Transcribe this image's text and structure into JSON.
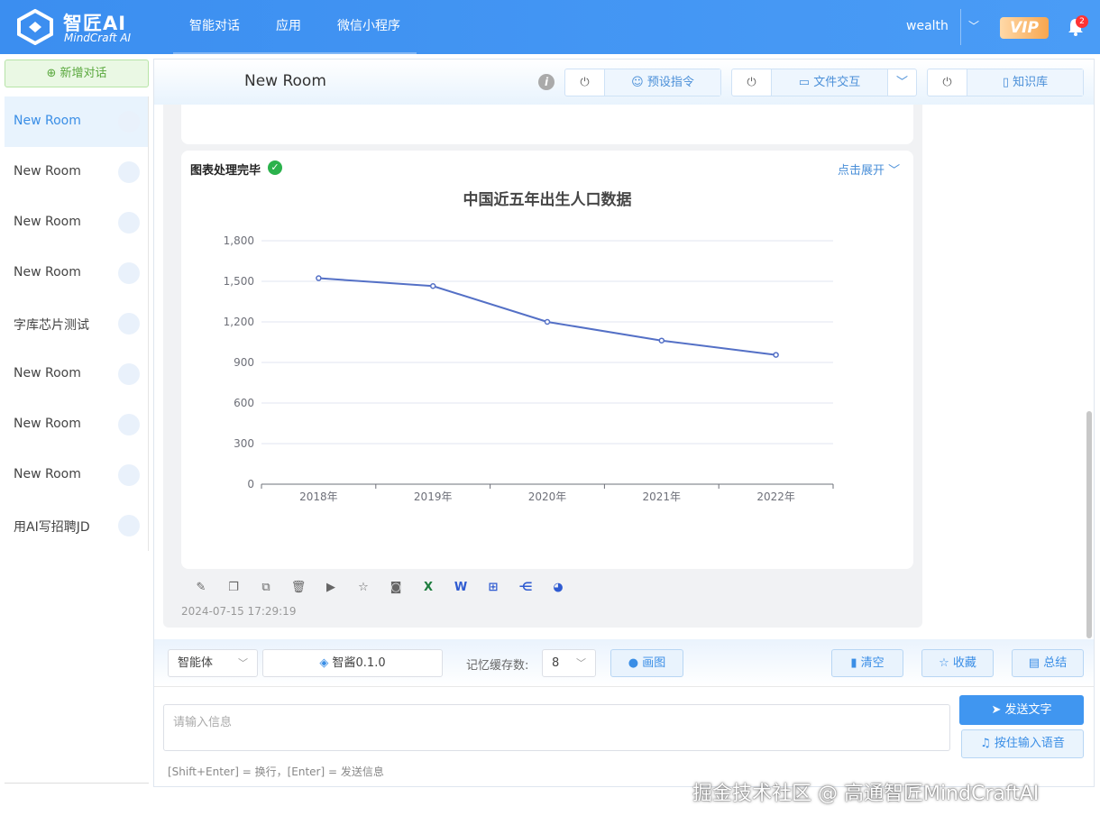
{
  "app": {
    "logo_title": "智匠AI",
    "logo_sub": "MindCraft AI",
    "nav": [
      "智能对话",
      "应用",
      "微信小程序"
    ],
    "user": "wealth",
    "vip": "VIP",
    "notifications": "2"
  },
  "sidebar": {
    "new_chat": "新增对话",
    "sessions": [
      "New Room",
      "New Room",
      "New Room",
      "New Room",
      "字库芯片测试",
      "New Room",
      "New Room",
      "New Room",
      "用AI写招聘JD"
    ]
  },
  "header": {
    "room_title": "New Room",
    "preset_label": "预设指令",
    "file_label": "文件交互",
    "kb_label": "知识库"
  },
  "message": {
    "status": "图表处理完毕",
    "expand": "点击展开",
    "timestamp": "2024-07-15 17:29:19"
  },
  "chart_data": {
    "type": "line",
    "title": "中国近五年出生人口数据",
    "categories": [
      "2018年",
      "2019年",
      "2020年",
      "2021年",
      "2022年"
    ],
    "values": [
      1523,
      1465,
      1200,
      1062,
      956
    ],
    "y_ticks": [
      "0",
      "300",
      "600",
      "900",
      "1,200",
      "1,500",
      "1,800"
    ],
    "ylim": [
      0,
      1800
    ],
    "color": "#5470c6",
    "grid": true
  },
  "controls": {
    "agent": "智能体",
    "model": "智酱0.1.0",
    "memory_label": "记忆缓存数:",
    "memory_value": "8",
    "draw": "画图",
    "clear": "清空",
    "favorite": "收藏",
    "summary": "总结"
  },
  "input": {
    "placeholder": "请输入信息",
    "hint": "[Shift+Enter] = 换行，[Enter] = 发送信息",
    "send": "发送文字",
    "voice": "按住输入语音"
  },
  "watermark": "掘金技术社区 @ 高通智匠MindCraftAI"
}
